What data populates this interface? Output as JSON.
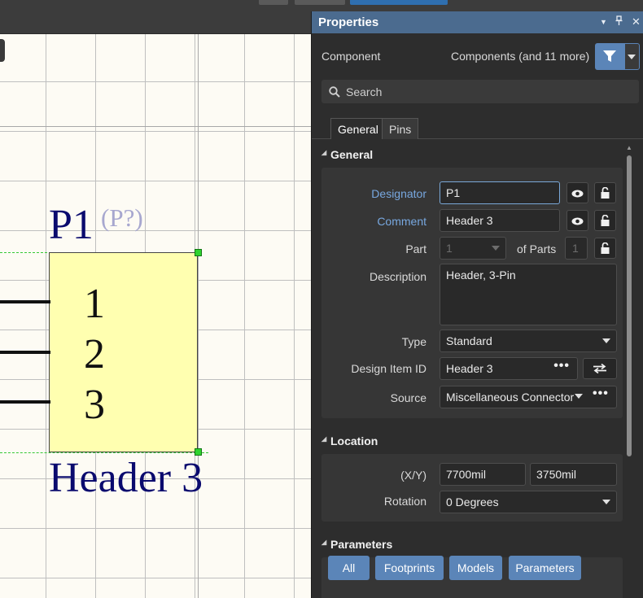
{
  "schematic": {
    "designator": "P1",
    "designator_hint": "(P?)",
    "comment": "Header 3",
    "pins": [
      "1",
      "2",
      "3"
    ]
  },
  "panel": {
    "title": "Properties",
    "component_label": "Component",
    "components_more": "Components (and 11 more)",
    "search_placeholder": "Search",
    "tabs": [
      "General",
      "Pins"
    ],
    "general": {
      "heading": "General",
      "designator_label": "Designator",
      "designator_value": "P1",
      "comment_label": "Comment",
      "comment_value": "Header 3",
      "part_label": "Part",
      "part_value": "1",
      "of_parts_label": "of Parts",
      "of_parts_value": "1",
      "description_label": "Description",
      "description_value": "Header, 3-Pin",
      "type_label": "Type",
      "type_value": "Standard",
      "design_item_label": "Design Item ID",
      "design_item_value": "Header 3",
      "source_label": "Source",
      "source_value": "Miscellaneous Connector"
    },
    "location": {
      "heading": "Location",
      "xy_label": "(X/Y)",
      "x_value": "7700mil",
      "y_value": "3750mil",
      "rotation_label": "Rotation",
      "rotation_value": "0 Degrees"
    },
    "parameters": {
      "heading": "Parameters",
      "buttons": [
        "All",
        "Footprints",
        "Models",
        "Parameters"
      ]
    }
  },
  "colors": {
    "panel_header": "#4b6b8f",
    "accent_button": "#5b85b8",
    "component_fill": "#ffffb0",
    "designator_text": "#0a0a6e",
    "selection_handle": "#2fd32f"
  }
}
